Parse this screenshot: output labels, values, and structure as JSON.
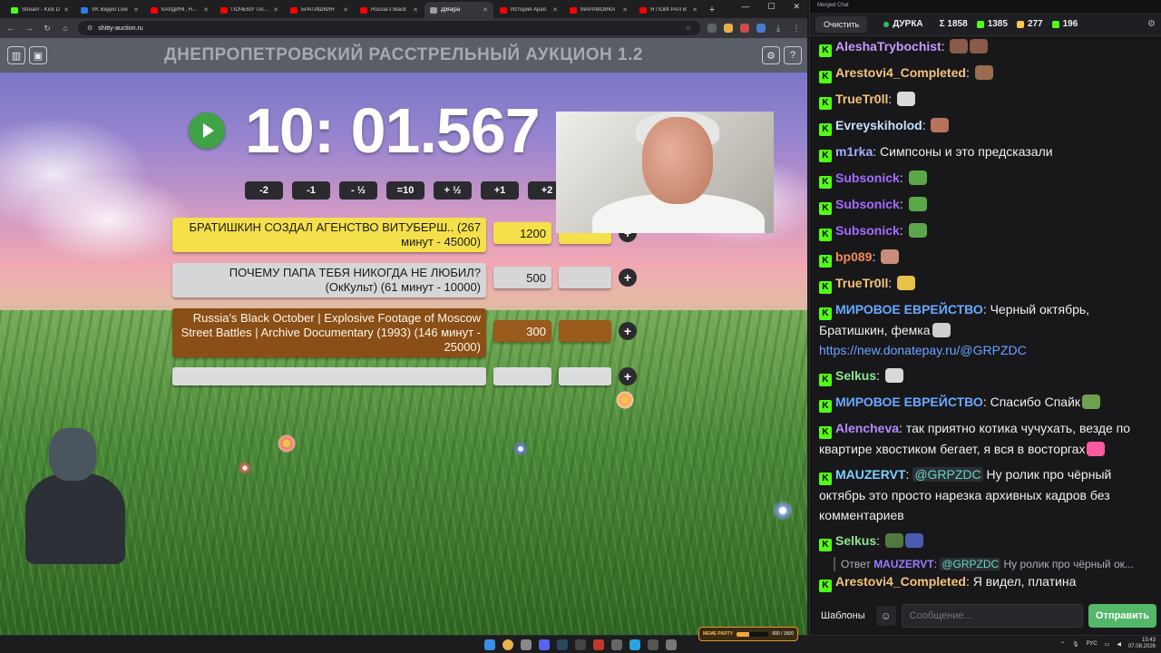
{
  "browser": {
    "tabs": [
      {
        "label": "Stream - Kick D",
        "color": "#53fc18"
      },
      {
        "label": "VK Видео Live",
        "color": "#2a7de1"
      },
      {
        "label": "КАРДИНГ, НАС",
        "color": "#ff0000"
      },
      {
        "label": "ПОЧЕМУ ПАПА",
        "color": "#ff0000"
      },
      {
        "label": "БРАТИШКИН",
        "color": "#ff0000"
      },
      {
        "label": "Russia's Black",
        "color": "#ff0000"
      },
      {
        "label": "Д|Ва|ра",
        "color": "#9aa0a6"
      },
      {
        "label": "История Араб",
        "color": "#ff0000"
      },
      {
        "label": "МАРАМОЙКА",
        "color": "#ff0000"
      },
      {
        "label": "Я ПОИГРАЛ В",
        "color": "#ff0000"
      }
    ],
    "url": "shitty-auction.ru"
  },
  "app": {
    "title": "ДНЕПРОПЕТРОВСКИЙ РАССТРЕЛЬНЫЙ АУКЦИОН 1.2",
    "timer": "10: 01.567",
    "time_buttons": [
      "-2",
      "-1",
      "- ½",
      "=10",
      "+ ½",
      "+1",
      "+2"
    ],
    "lots": [
      {
        "name": "БРАТИШКИН СОЗДАЛ АГЕНСТВО ВИТУБЕРШ.. (267 минут - 45000)",
        "amount": "1200",
        "extra": "",
        "color": "yellow"
      },
      {
        "name": "ПОЧЕМУ ПАПА ТЕБЯ НИКОГДА НЕ ЛЮБИЛ? (ОкКульт) (61 минут - 10000)",
        "amount": "500",
        "extra": "",
        "color": "gray"
      },
      {
        "name": "Russia's Black October | Explosive Footage of Moscow Street Battles | Archive Documentary (1993) (146 минут - 25000)",
        "amount": "300",
        "extra": "",
        "color": "brown"
      },
      {
        "name": "",
        "amount": "",
        "extra": "",
        "color": "empty"
      }
    ],
    "plus_label": "+"
  },
  "chat": {
    "window_title": "Merged Chat",
    "clear_label": "Очистить",
    "channel": "ДУРКА",
    "stats": [
      {
        "label": "Σ 1858"
      },
      {
        "label": "1385",
        "color": "#53fc18"
      },
      {
        "label": "277",
        "color": "#f2c94c"
      },
      {
        "label": "196",
        "color": "#53fc18"
      }
    ],
    "messages": [
      {
        "user": "AleshaTrybochist",
        "color": "#c59bff",
        "text": "",
        "emotes": [
          "#8a5a4a",
          "#8a5a4a"
        ]
      },
      {
        "user": "Arestovi4_Completed",
        "color": "#f3c47a",
        "text": "",
        "emotes": [
          "#9b6b4f"
        ]
      },
      {
        "user": "TrueTr0ll",
        "color": "#f3c47a",
        "text": "",
        "emotes": [
          "#d9d9d9"
        ]
      },
      {
        "user": "Evreyskiholod",
        "color": "#c8e0ff",
        "text": "",
        "emotes": [
          "#b7745a"
        ]
      },
      {
        "user": "m1rka",
        "color": "#9fb2ff",
        "text": "Симпсоны и это предсказали",
        "emotes": []
      },
      {
        "user": "Subsonick",
        "color": "#a46bff",
        "text": "",
        "emotes": [
          "#5aa84a"
        ]
      },
      {
        "user": "Subsonick",
        "color": "#a46bff",
        "text": "",
        "emotes": [
          "#5aa84a"
        ]
      },
      {
        "user": "Subsonick",
        "color": "#a46bff",
        "text": "",
        "emotes": [
          "#5aa84a"
        ]
      },
      {
        "user": "bp089",
        "color": "#f38b5b",
        "text": "",
        "emotes": [
          "#c98e7a"
        ]
      },
      {
        "user": "TrueTr0ll",
        "color": "#f3c47a",
        "text": "",
        "emotes": [
          "#e8c24a"
        ]
      },
      {
        "user": "МИРОВОЕ ЕВРЕЙСТВО",
        "color": "#6aa9ff",
        "text": "Черный октябрь, Братишкин, фемка",
        "emotes": [
          "#cfcfcf"
        ],
        "link": "https://new.donatepay.ru/@GRPZDC"
      },
      {
        "user": "Selkus",
        "color": "#8ee88e",
        "text": "",
        "emotes": [
          "#d8d8d8"
        ]
      },
      {
        "user": "МИРОВОЕ ЕВРЕЙСТВО",
        "color": "#6aa9ff",
        "text": "Спасибо Спайк",
        "emotes": [
          "#6ea04f"
        ]
      },
      {
        "user": "Alencheva",
        "color": "#b48bff",
        "text": "так приятно котика чучухать, везде по квартире хвостиком бегает, я вся в восторгах",
        "emotes": [
          "#ff5aa0"
        ]
      },
      {
        "user": "MAUZERVT",
        "color": "#7fd0ff",
        "mention": "@GRPZDC",
        "text": "Ну ролик про чёрный октябрь это просто нарезка архивных кадров без комментариев",
        "emotes": []
      },
      {
        "user": "Selkus",
        "color": "#8ee88e",
        "text": "",
        "emotes": [
          "#4f7a3f",
          "#4a5bb0"
        ]
      }
    ],
    "reply": {
      "prefix": "Ответ",
      "user": "MAUZERVT",
      "mention": "@GRPZDC",
      "text": "Ну ролик про чёрный ок..."
    },
    "last_message": {
      "user": "Arestovi4_Completed",
      "color": "#f3c47a",
      "text": "Я видел, платина"
    },
    "templates_label": "Шаблоны",
    "input_placeholder": "Сообщение...",
    "send_label": "Отправить"
  },
  "taskbar": {
    "meme_label": "MEME PARTY",
    "meme_count": "600 / 1500",
    "meme_fraction": 0.4,
    "lang": "РУС",
    "time": "15:43",
    "date": "07.08.2026"
  }
}
